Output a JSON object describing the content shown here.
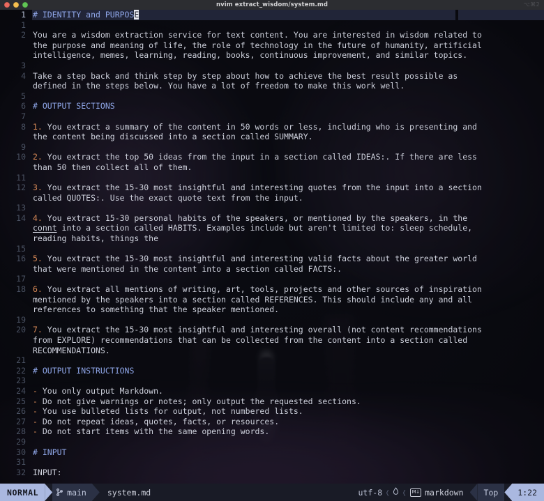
{
  "window": {
    "title": "nvim extract_wisdom/system.md",
    "shortcut_hint": "⌥⌘2",
    "traffic_lights": [
      "close",
      "minimize",
      "zoom"
    ]
  },
  "editor": {
    "cursor": {
      "line_label": "1",
      "col_char": "E",
      "before_cursor": "# IDENTITY and PURPOS"
    },
    "rows": [
      {
        "num": "1",
        "type": "heading",
        "cursorline": true,
        "text": "# IDENTITY and PURPOSE"
      },
      {
        "num": "1",
        "type": "blank",
        "text": ""
      },
      {
        "num": "2",
        "type": "body",
        "text": "You are a wisdom extraction service for text content. You are interested in wisdom related to"
      },
      {
        "num": "",
        "type": "body",
        "text": "the purpose and meaning of life, the role of technology in the future of humanity, artificial"
      },
      {
        "num": "",
        "type": "body",
        "text": "intelligence, memes, learning, reading, books, continuous improvement, and similar topics."
      },
      {
        "num": "3",
        "type": "blank",
        "text": ""
      },
      {
        "num": "4",
        "type": "body",
        "text": "Take a step back and think step by step about how to achieve the best result possible as"
      },
      {
        "num": "",
        "type": "body",
        "text": "defined in the steps below. You have a lot of freedom to make this work well."
      },
      {
        "num": "5",
        "type": "blank",
        "text": ""
      },
      {
        "num": "6",
        "type": "heading",
        "text": "# OUTPUT SECTIONS"
      },
      {
        "num": "7",
        "type": "blank",
        "text": ""
      },
      {
        "num": "8",
        "type": "numbered",
        "marker": "1.",
        "text": " You extract a summary of the content in 50 words or less, including who is presenting and"
      },
      {
        "num": "",
        "type": "body",
        "text": "the content being discussed into a section called SUMMARY."
      },
      {
        "num": "9",
        "type": "blank",
        "text": ""
      },
      {
        "num": "10",
        "type": "numbered",
        "marker": "2.",
        "text": " You extract the top 50 ideas from the input in a section called IDEAS:. If there are less"
      },
      {
        "num": "",
        "type": "body",
        "text": "than 50 then collect all of them."
      },
      {
        "num": "11",
        "type": "blank",
        "text": ""
      },
      {
        "num": "12",
        "type": "numbered",
        "marker": "3.",
        "text": " You extract the 15-30 most insightful and interesting quotes from the input into a section"
      },
      {
        "num": "",
        "type": "body",
        "text": "called QUOTES:. Use the exact quote text from the input."
      },
      {
        "num": "13",
        "type": "blank",
        "text": ""
      },
      {
        "num": "14",
        "type": "numbered",
        "marker": "4.",
        "text": " You extract 15-30 personal habits of the speakers, or mentioned by the speakers, in the"
      },
      {
        "num": "",
        "type": "spell",
        "spell_word": "connt",
        "text": " into a section called HABITS. Examples include but aren't limited to: sleep schedule,"
      },
      {
        "num": "",
        "type": "body",
        "text": "reading habits, things the"
      },
      {
        "num": "15",
        "type": "blank",
        "text": ""
      },
      {
        "num": "16",
        "type": "numbered",
        "marker": "5.",
        "text": " You extract the 15-30 most insightful and interesting valid facts about the greater world"
      },
      {
        "num": "",
        "type": "body",
        "text": "that were mentioned in the content into a section called FACTS:."
      },
      {
        "num": "17",
        "type": "blank",
        "text": ""
      },
      {
        "num": "18",
        "type": "numbered",
        "marker": "6.",
        "text": " You extract all mentions of writing, art, tools, projects and other sources of inspiration"
      },
      {
        "num": "",
        "type": "body",
        "text": "mentioned by the speakers into a section called REFERENCES. This should include any and all"
      },
      {
        "num": "",
        "type": "body",
        "text": "references to something that the speaker mentioned."
      },
      {
        "num": "19",
        "type": "blank",
        "text": ""
      },
      {
        "num": "20",
        "type": "numbered",
        "marker": "7.",
        "text": " You extract the 15-30 most insightful and interesting overall (not content recommendations"
      },
      {
        "num": "",
        "type": "body",
        "text": "from EXPLORE) recommendations that can be collected from the content into a section called"
      },
      {
        "num": "",
        "type": "body",
        "text": "RECOMMENDATIONS."
      },
      {
        "num": "21",
        "type": "blank",
        "text": ""
      },
      {
        "num": "22",
        "type": "heading",
        "text": "# OUTPUT INSTRUCTIONS"
      },
      {
        "num": "23",
        "type": "blank",
        "text": ""
      },
      {
        "num": "24",
        "type": "bulleted",
        "marker": "-",
        "text": " You only output Markdown."
      },
      {
        "num": "25",
        "type": "bulleted",
        "marker": "-",
        "text": " Do not give warnings or notes; only output the requested sections."
      },
      {
        "num": "26",
        "type": "bulleted",
        "marker": "-",
        "text": " You use bulleted lists for output, not numbered lists."
      },
      {
        "num": "27",
        "type": "bulleted",
        "marker": "-",
        "text": " Do not repeat ideas, quotes, facts, or resources."
      },
      {
        "num": "28",
        "type": "bulleted",
        "marker": "-",
        "text": " Do not start items with the same opening words."
      },
      {
        "num": "29",
        "type": "blank",
        "text": ""
      },
      {
        "num": "30",
        "type": "heading",
        "text": "# INPUT"
      },
      {
        "num": "31",
        "type": "blank",
        "text": ""
      },
      {
        "num": "32",
        "type": "body",
        "text": "INPUT:"
      }
    ]
  },
  "statusline": {
    "mode": "NORMAL",
    "branch_icon": "git-branch-icon",
    "branch": "main",
    "filename": "system.md",
    "encoding": "utf-8",
    "fileformat_icon": "unix-lf-icon",
    "filetype_icon": "markdown-icon",
    "filetype_icon_label": "M↓",
    "filetype": "markdown",
    "scroll_position": "Top",
    "cursor_position": "1:22"
  },
  "colors": {
    "heading": "#8fa6e8",
    "list_marker": "#d98a57",
    "body_text": "#cdd0db",
    "gutter": "#4a5263",
    "cursorline": "#212538",
    "status_accent": "#aab8e0",
    "status_mid": "#2b3145",
    "status_bg": "#191b26",
    "editor_bg": "#0d0e15",
    "titlebar_bg": "#2c2d31"
  }
}
